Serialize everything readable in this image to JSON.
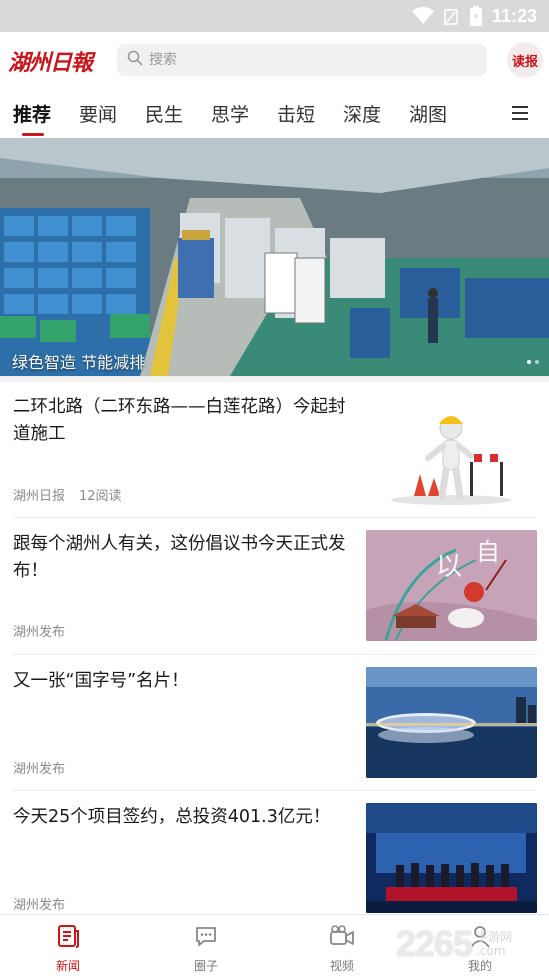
{
  "status_bar": {
    "time": "11:23",
    "icons": [
      "wifi-icon",
      "signal-icon",
      "battery-icon"
    ]
  },
  "header": {
    "logo_text": "湖州日報",
    "search_placeholder": "搜索",
    "read_button": "读报"
  },
  "tabs": [
    {
      "label": "推荐",
      "active": true
    },
    {
      "label": "要闻",
      "active": false
    },
    {
      "label": "民生",
      "active": false
    },
    {
      "label": "思学",
      "active": false
    },
    {
      "label": "击短",
      "active": false
    },
    {
      "label": "深度",
      "active": false
    },
    {
      "label": "湖图",
      "active": false
    }
  ],
  "banner": {
    "caption": "绿色智造 节能减排"
  },
  "news": [
    {
      "title": "二环北路（二环东路——白莲花路）今起封道施工",
      "source": "湖州日报",
      "reads": "12阅读"
    },
    {
      "title": "跟每个湖州人有关，这份倡议书今天正式发布！",
      "source": "湖州发布",
      "reads": ""
    },
    {
      "title": "又一张“国字号”名片！",
      "source": "湖州发布",
      "reads": ""
    },
    {
      "title": "今天25个项目签约，总投资401.3亿元！",
      "source": "湖州发布",
      "reads": ""
    }
  ],
  "bottom_nav": [
    {
      "label": "新闻",
      "icon": "news-icon",
      "active": true
    },
    {
      "label": "圈子",
      "icon": "chat-icon",
      "active": false
    },
    {
      "label": "视频",
      "icon": "video-icon",
      "active": false
    },
    {
      "label": "我的",
      "icon": "profile-icon",
      "active": false
    }
  ],
  "watermark": {
    "big": "2265",
    "small_top": "手游网",
    "small_bottom": ".com"
  },
  "colors": {
    "brand_red": "#c8161d",
    "status_bar": "#d9d9d9",
    "muted_text": "#8a8a8a"
  }
}
